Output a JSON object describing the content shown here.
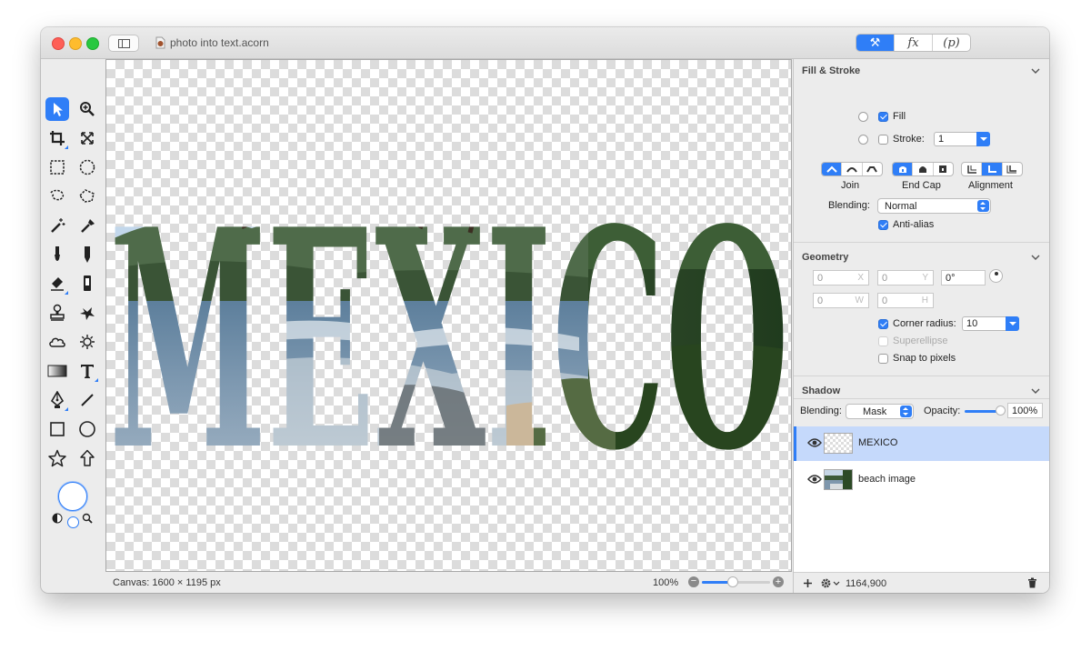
{
  "window": {
    "title": "photo into text.acorn",
    "inspector_tabs": [
      "⚒",
      "fx",
      "(p)"
    ]
  },
  "canvas": {
    "text": "MEXICO",
    "info": "Canvas: 1600 × 1195 px",
    "zoom_label": "100%",
    "zoom_fraction": 0.45
  },
  "toolbox": {
    "tools": [
      "select-arrow-icon",
      "zoom-icon",
      "crop-icon",
      "transform-icon",
      "rect-select-icon",
      "ellipse-select-icon",
      "lasso-icon",
      "poly-lasso-icon",
      "magic-wand-icon",
      "smart-wand-icon",
      "brush-icon",
      "pencil-icon",
      "eraser-icon",
      "fill-bucket-icon",
      "clone-stamp-icon",
      "heal-icon",
      "cloud-icon",
      "sun-icon",
      "gradient-icon",
      "text-tool-icon",
      "pen-tool-icon",
      "line-tool-icon",
      "rectangle-tool-icon",
      "circle-tool-icon",
      "star-tool-icon",
      "arrow-tool-icon"
    ],
    "active_tool": "select-arrow-icon"
  },
  "fill_stroke": {
    "title": "Fill & Stroke",
    "fill_label": "Fill",
    "fill_checked": true,
    "stroke_label": "Stroke:",
    "stroke_checked": false,
    "stroke_width": "1",
    "join_label": "Join",
    "endcap_label": "End Cap",
    "alignment_label": "Alignment",
    "blending_label": "Blending:",
    "blending_value": "Normal",
    "antialias_label": "Anti-alias",
    "antialias_checked": true
  },
  "geometry": {
    "title": "Geometry",
    "x_value": "0",
    "x_unit": "X",
    "y_value": "0",
    "y_unit": "Y",
    "rotation": "0°",
    "w_value": "0",
    "w_unit": "W",
    "h_value": "0",
    "h_unit": "H",
    "corner_radius_label": "Corner radius:",
    "corner_radius_value": "10",
    "corner_radius_checked": true,
    "superellipse_label": "Superellipse",
    "snap_label": "Snap to pixels"
  },
  "shadow": {
    "title": "Shadow"
  },
  "layer_blend": {
    "blending_label": "Blending:",
    "blending_value": "Mask",
    "opacity_label": "Opacity:",
    "opacity_value": "100%",
    "opacity_fraction": 1.0
  },
  "layers": [
    {
      "name": "MEXICO",
      "selected": true
    },
    {
      "name": "beach image",
      "selected": false
    }
  ],
  "inspector_footer": {
    "coords": "1164,900"
  },
  "colors": {
    "accent": "#2f7ef7",
    "selection": "#c5d9fb"
  }
}
